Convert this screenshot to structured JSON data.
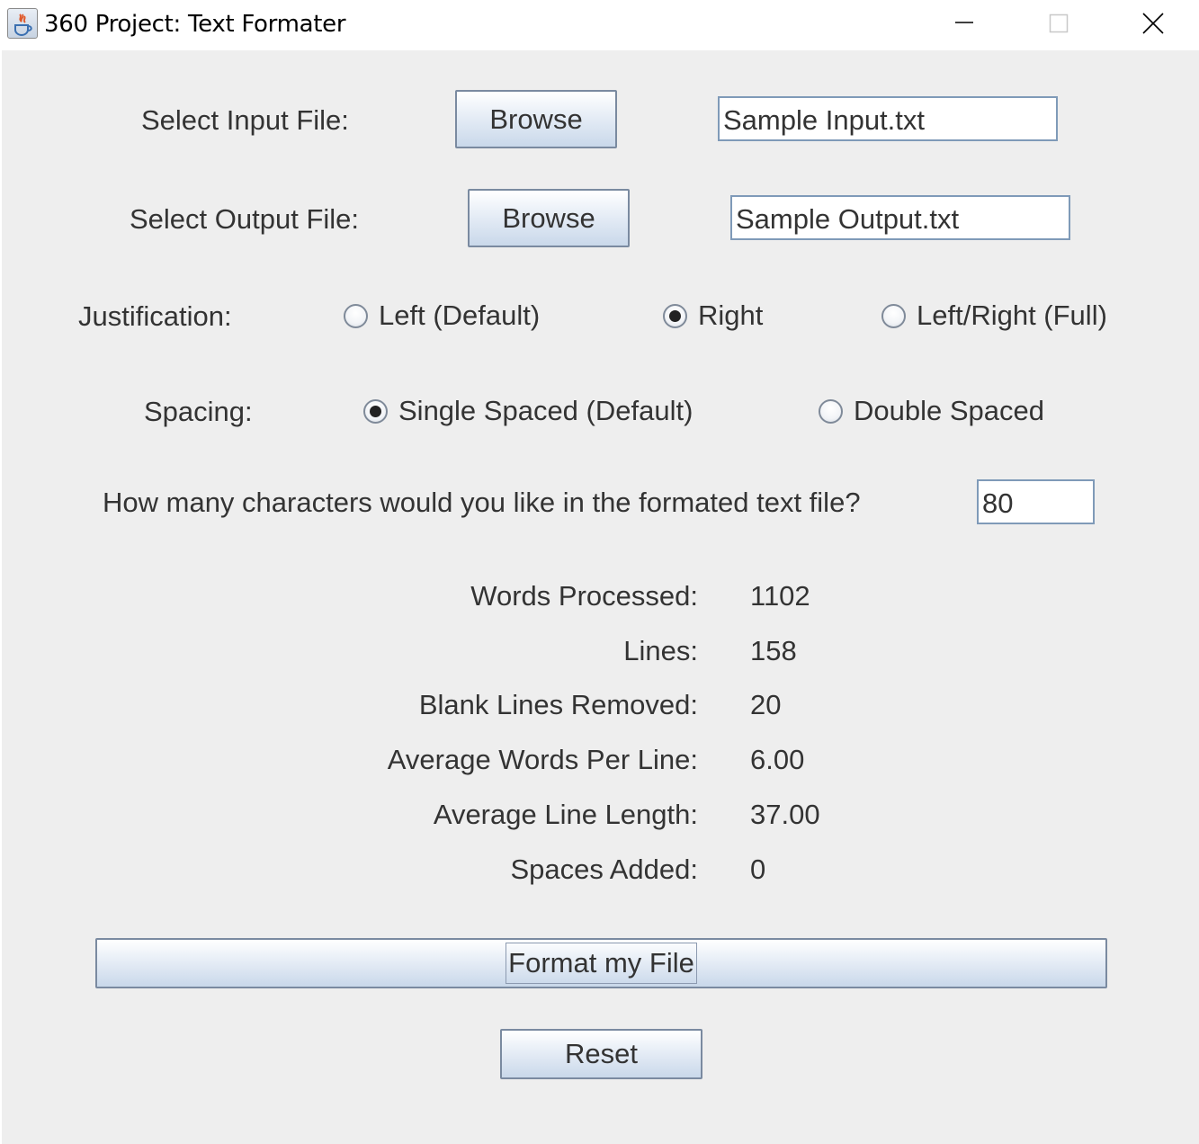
{
  "window": {
    "title": "360 Project: Text Formater"
  },
  "input_file": {
    "label": "Select Input File:",
    "browse_label": "Browse",
    "value": "Sample Input.txt"
  },
  "output_file": {
    "label": "Select Output File:",
    "browse_label": "Browse",
    "value": "Sample Output.txt"
  },
  "justification": {
    "label": "Justification:",
    "options": [
      {
        "label": "Left (Default)",
        "checked": false
      },
      {
        "label": "Right",
        "checked": true
      },
      {
        "label": "Left/Right (Full)",
        "checked": false
      }
    ]
  },
  "spacing": {
    "label": "Spacing:",
    "options": [
      {
        "label": "Single Spaced (Default)",
        "checked": true
      },
      {
        "label": "Double Spaced",
        "checked": false
      }
    ]
  },
  "line_length": {
    "question": "How many characters would you like in the formated text file?",
    "value": "80"
  },
  "stats": [
    {
      "label": "Words Processed:",
      "value": "1102"
    },
    {
      "label": "Lines:",
      "value": "158"
    },
    {
      "label": "Blank Lines Removed:",
      "value": "20"
    },
    {
      "label": "Average Words Per Line:",
      "value": "6.00"
    },
    {
      "label": "Average Line Length:",
      "value": "37.00"
    },
    {
      "label": "Spaces Added:",
      "value": "0"
    }
  ],
  "actions": {
    "format_label": "Format my File",
    "reset_label": "Reset"
  },
  "colors": {
    "background": "#eeeeee",
    "button_border": "#7a8aa0",
    "field_border": "#7f9ab8"
  },
  "icons": {
    "app": "java-icon",
    "minimize": "minimize-icon",
    "maximize": "maximize-icon",
    "close": "close-icon"
  }
}
